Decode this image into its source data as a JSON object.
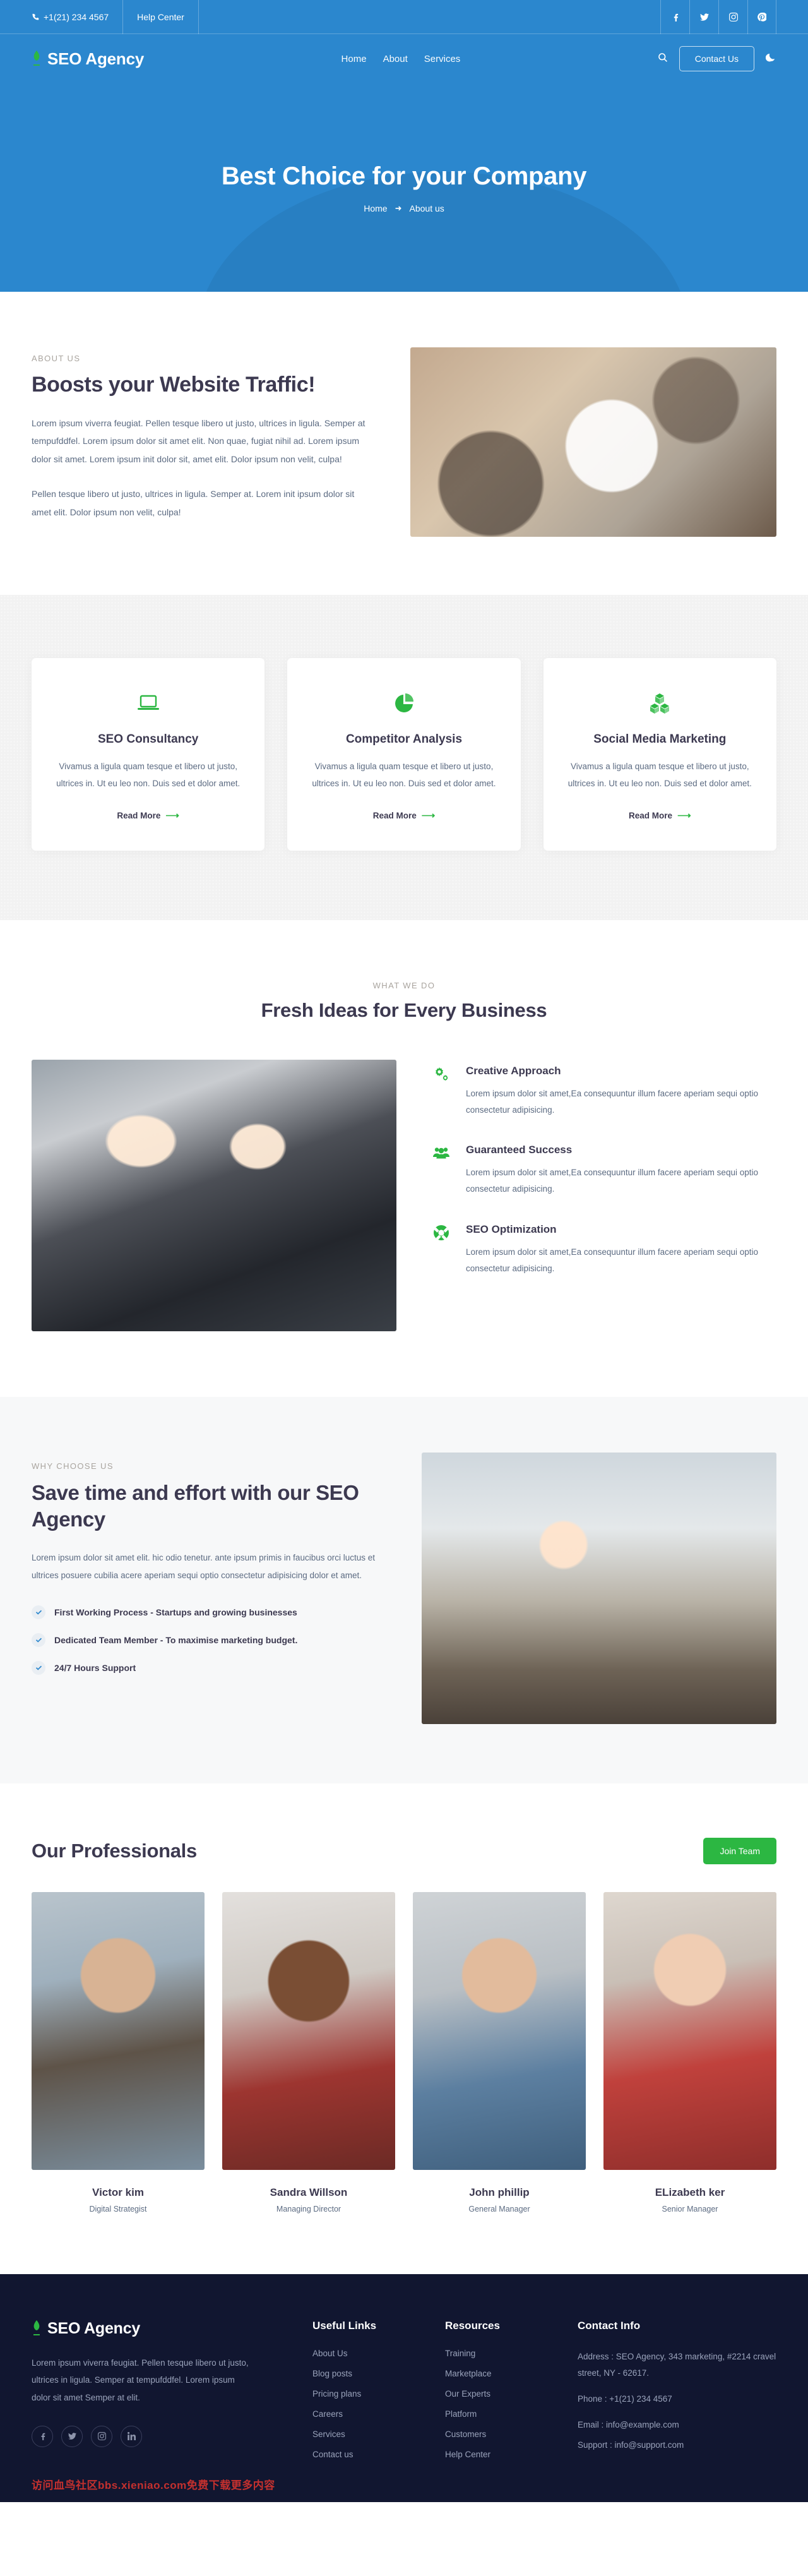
{
  "topbar": {
    "phone": "+1(21) 234 4567",
    "help": "Help Center",
    "socials": [
      "facebook-icon",
      "twitter-icon",
      "instagram-icon",
      "pinterest-icon"
    ]
  },
  "nav": {
    "brand": "SEO Agency",
    "links": [
      "Home",
      "About",
      "Services"
    ],
    "search": "search-icon",
    "contact_btn": "Contact Us",
    "theme_toggle": "moon-icon"
  },
  "hero": {
    "title": "Best Choice for your Company",
    "crumb_home": "Home",
    "crumb_sep": "➜",
    "crumb_current": "About us"
  },
  "about": {
    "eyebrow": "ABOUT US",
    "title": "Boosts your Website Traffic!",
    "p1": "Lorem ipsum viverra feugiat. Pellen tesque libero ut justo, ultrices in ligula. Semper at tempufddfel. Lorem ipsum dolor sit amet elit. Non quae, fugiat nihil ad. Lorem ipsum dolor sit amet. Lorem ipsum init dolor sit, amet elit. Dolor ipsum non velit, culpa!",
    "p2": "Pellen tesque libero ut justo, ultrices in ligula. Semper at. Lorem init ipsum dolor sit amet elit. Dolor ipsum non velit, culpa!"
  },
  "services": {
    "read_more": "Read More",
    "cards": [
      {
        "icon": "laptop-icon",
        "title": "SEO Consultancy",
        "text": "Vivamus a ligula quam tesque et libero ut justo, ultrices in. Ut eu leo non. Duis sed et dolor amet."
      },
      {
        "icon": "pie-chart-icon",
        "title": "Competitor Analysis",
        "text": "Vivamus a ligula quam tesque et libero ut justo, ultrices in. Ut eu leo non. Duis sed et dolor amet."
      },
      {
        "icon": "cubes-icon",
        "title": "Social Media Marketing",
        "text": "Vivamus a ligula quam tesque et libero ut justo, ultrices in. Ut eu leo non. Duis sed et dolor amet."
      }
    ]
  },
  "what_we_do": {
    "eyebrow": "WHAT WE DO",
    "title": "Fresh Ideas for Every Business",
    "features": [
      {
        "icon": "gears-icon",
        "title": "Creative Approach",
        "text": "Lorem ipsum dolor sit amet,Ea consequuntur illum facere aperiam sequi optio consectetur adipisicing."
      },
      {
        "icon": "users-icon",
        "title": "Guaranteed Success",
        "text": "Lorem ipsum dolor sit amet,Ea consequuntur illum facere aperiam sequi optio consectetur adipisicing."
      },
      {
        "icon": "lifebuoy-icon",
        "title": "SEO Optimization",
        "text": "Lorem ipsum dolor sit amet,Ea consequuntur illum facere aperiam sequi optio consectetur adipisicing."
      }
    ]
  },
  "why_choose": {
    "eyebrow": "WHY CHOOSE US",
    "title": "Save time and effort with our SEO Agency",
    "lead": "Lorem ipsum dolor sit amet elit. hic odio tenetur. ante ipsum primis in faucibus orci luctus et ultrices posuere cubilia acere aperiam sequi optio consectetur adipisicing dolor et amet.",
    "checks": [
      "First Working Process - Startups and growing businesses",
      "Dedicated Team Member - To maximise marketing budget.",
      "24/7 Hours Support"
    ]
  },
  "team": {
    "title": "Our Professionals",
    "join_btn": "Join Team",
    "members": [
      {
        "name": "Victor kim",
        "role": "Digital Strategist"
      },
      {
        "name": "Sandra Willson",
        "role": "Managing Director"
      },
      {
        "name": "John phillip",
        "role": "General Manager"
      },
      {
        "name": "ELizabeth ker",
        "role": "Senior Manager"
      }
    ]
  },
  "footer": {
    "brand": "SEO Agency",
    "about": "Lorem ipsum viverra feugiat. Pellen tesque libero ut justo, ultrices in ligula. Semper at tempufddfel. Lorem ipsum dolor sit amet Semper at elit.",
    "socials": [
      "facebook-icon",
      "twitter-icon",
      "instagram-icon",
      "linkedin-icon"
    ],
    "useful": {
      "title": "Useful Links",
      "links": [
        "About Us",
        "Blog posts",
        "Pricing plans",
        "Careers",
        "Services",
        "Contact us"
      ]
    },
    "resources": {
      "title": "Resources",
      "links": [
        "Training",
        "Marketplace",
        "Our Experts",
        "Platform",
        "Customers",
        "Help Center"
      ]
    },
    "contact": {
      "title": "Contact Info",
      "address": "Address : SEO Agency, 343 marketing, #2214 cravel street, NY - 62617.",
      "phone": "Phone : +1(21) 234 4567",
      "email": "Email : info@example.com",
      "support": "Support : info@support.com"
    },
    "watermark": "访问血鸟社区bbs.xieniao.com免费下载更多内容"
  },
  "colors": {
    "brand_blue": "#2b87ce",
    "accent_green": "#2cb742",
    "footer_dark": "#111630",
    "heading": "#3c3950",
    "body_text": "#5c6b82"
  }
}
